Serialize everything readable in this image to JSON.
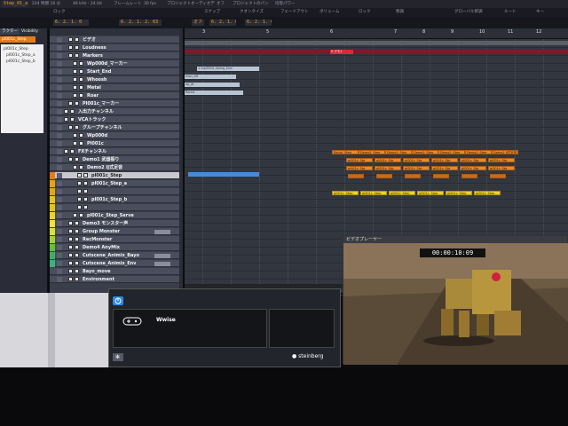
{
  "header": {
    "project_tab": "Step_01_a",
    "info_segments": [
      "224 時間 16 分",
      "48 kHz - 24 bit",
      "フレームレート",
      "30 fps",
      "プロジェクトオーディオデ",
      "オフ",
      "プロジェクトのパン",
      "均等パワー"
    ],
    "lcd_values": [
      "6. 2. 1. 0",
      "6. 2. 1. 2. 63",
      "オフ",
      "6. 2. 1. 0",
      "6. 2. 1. 0"
    ],
    "field_labels": [
      "ロック",
      "スナップ",
      "クオンタイズ",
      "フェードイン",
      "フェードアウト",
      "ボリューム",
      "ロック",
      "移調",
      "グローバル移調",
      "ルート",
      "キー"
    ]
  },
  "inspector": {
    "tabs": [
      "ラクター",
      "Visibility"
    ],
    "selected_item": "pl001c_Step",
    "list": [
      "pl001c_Step",
      "pl001c_Step_a",
      "pl001c_Step_b"
    ]
  },
  "tracklist": {
    "tracks": [
      {
        "label": "ビデオ",
        "indent": 1,
        "color": ""
      },
      {
        "label": "Loudness",
        "indent": 1,
        "color": ""
      },
      {
        "label": "Markers",
        "indent": 1,
        "color": ""
      },
      {
        "label": "Wp000d_マーカー",
        "indent": 2,
        "color": ""
      },
      {
        "label": "Start_End",
        "indent": 2,
        "color": ""
      },
      {
        "label": "Whoosh",
        "indent": 2,
        "color": ""
      },
      {
        "label": "Metal",
        "indent": 2,
        "color": ""
      },
      {
        "label": "Roar",
        "indent": 2,
        "color": ""
      },
      {
        "label": "Pl001c_マーカー",
        "indent": 1,
        "color": ""
      },
      {
        "label": "入出力チャンネル",
        "indent": 0,
        "color": ""
      },
      {
        "label": "VCAトラック",
        "indent": 0,
        "color": ""
      },
      {
        "label": "グループチャンネル",
        "indent": 1,
        "color": ""
      },
      {
        "label": "Wp000d",
        "indent": 2,
        "color": ""
      },
      {
        "label": "Pl001c",
        "indent": 2,
        "color": ""
      },
      {
        "label": "FXチャンネル",
        "indent": 0,
        "color": ""
      },
      {
        "label": "Demo1 武器振り",
        "indent": 1,
        "color": ""
      },
      {
        "label": "Demo2 IJ式足音",
        "indent": 2,
        "color": ""
      },
      {
        "label": "pl001c_Step",
        "indent": 3,
        "color": "#e87a1a",
        "selected": true
      },
      {
        "label": "pl001c_Step_a",
        "indent": 3,
        "color": "#e8a020"
      },
      {
        "label": "",
        "indent": 3,
        "color": "#e8a020"
      },
      {
        "label": "pl001c_Step_b",
        "indent": 3,
        "color": "#e8c020"
      },
      {
        "label": "",
        "indent": 3,
        "color": "#e8c020"
      },
      {
        "label": "pl001c_Step_Serve",
        "indent": 2,
        "color": "#f0d030"
      },
      {
        "label": "Demo3 モンスター声",
        "indent": 1,
        "color": "#f0e040"
      },
      {
        "label": "Group Monster",
        "indent": 1,
        "color": "#d8e040",
        "chip": true
      },
      {
        "label": "RecMonster",
        "indent": 1,
        "color": "#a0d040"
      },
      {
        "label": "Demo4 AnyMix",
        "indent": 1,
        "color": "#60c040"
      },
      {
        "label": "Cutscene_Animix_Bayo",
        "indent": 1,
        "color": "#40b060",
        "chip": true
      },
      {
        "label": "Cutscene_Animix_Env",
        "indent": 1,
        "color": "#40b080",
        "chip": true
      },
      {
        "label": "Bayo_move",
        "indent": 1,
        "color": ""
      },
      {
        "label": "Environment",
        "indent": 1,
        "color": ""
      }
    ]
  },
  "arrange": {
    "bar_numbers": [
      "3",
      "5",
      "6",
      "7",
      "8",
      "9",
      "10",
      "11",
      "12"
    ],
    "marker_label": "0 デモ1",
    "small_events": [
      "1 mp000d_Swing_End",
      "mon_lift",
      "op_dr",
      "Rarnd"
    ],
    "orange_row_labels": [
      "Rarnd_Step",
      "Demo2_Step",
      "Demo2_Step",
      "Demo2_Step",
      "Demo2_Step",
      "Demo2_Step",
      "Demo2 IJ式足音"
    ],
    "step_events": [
      "pl001c_Ste",
      "pl001c_Ste",
      "pl001c_Ste",
      "pl001c_Ste",
      "pl001c_Ste",
      "pl001c_Ste"
    ],
    "yellow_events": [
      "pl001c_Step",
      "pl001c_Step",
      "pl001c_Step",
      "pl001c_Step",
      "pl001c_Step",
      "pl001c_Step"
    ]
  },
  "wwise": {
    "name": "Wwise",
    "brand": "steinberg"
  },
  "video": {
    "title": "ビデオプレーヤー",
    "timecode": "00:00:10:09"
  },
  "colors": {
    "accent_orange": "#e88a2a",
    "accent_yellow": "#f0d030",
    "selected_track": "#c8c8d0",
    "power_blue": "#2a8ae8"
  }
}
